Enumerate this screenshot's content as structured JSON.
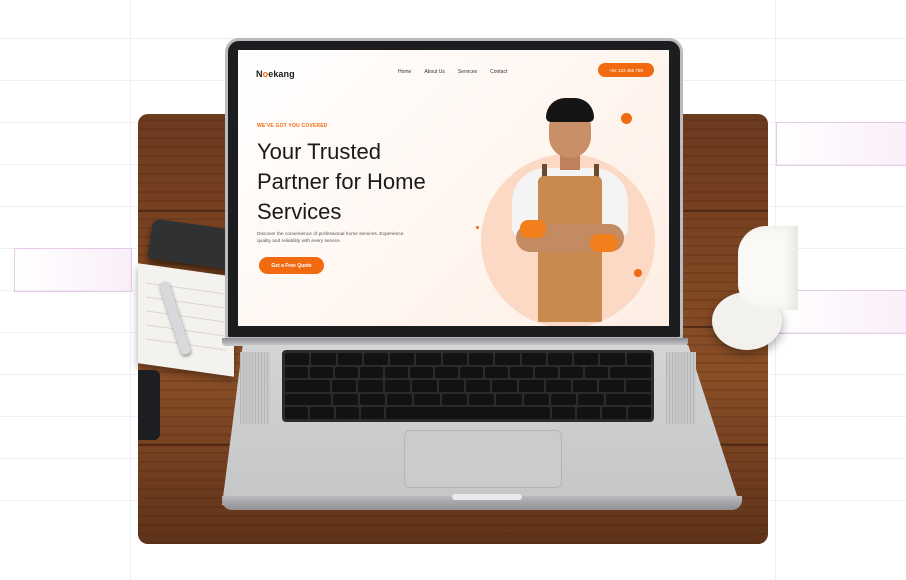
{
  "website": {
    "logo": {
      "prefix": "N",
      "accent": "o",
      "suffix": "ekang"
    },
    "nav": {
      "links": [
        "Home",
        "About Us",
        "Services",
        "Contact"
      ],
      "phone": "+62 123 456 789"
    },
    "hero": {
      "eyebrow": "WE'VE GOT YOU COVERED",
      "headline": [
        "Your Trusted",
        "Partner for Home",
        "Services"
      ],
      "description": "Discover the convenience of professional home services. Experience quality and reliability with every service.",
      "cta": "Get a Free Quote"
    }
  },
  "colors": {
    "accent": "#f26a10",
    "hero_circle": "#fcd9c4",
    "apron": "#c98a4f"
  },
  "icons": [
    "laptop",
    "notebook",
    "pen",
    "stapler",
    "phone",
    "coffee-cup"
  ]
}
